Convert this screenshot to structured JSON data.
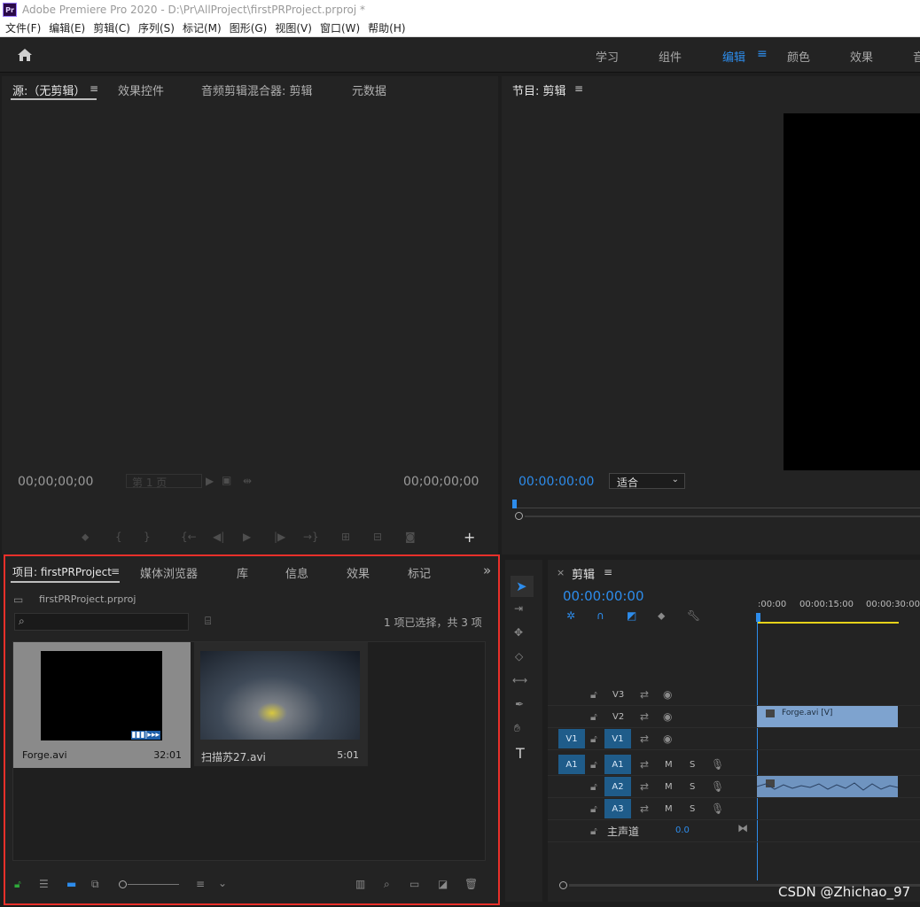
{
  "window": {
    "title": "Adobe Premiere Pro 2020 - D:\\Pr\\AllProject\\firstPRProject.prproj *",
    "logo": "Pr"
  },
  "menu": [
    "文件(F)",
    "编辑(E)",
    "剪辑(C)",
    "序列(S)",
    "标记(M)",
    "图形(G)",
    "视图(V)",
    "窗口(W)",
    "帮助(H)"
  ],
  "workspaces": {
    "items": [
      "学习",
      "组件",
      "编辑",
      "颜色",
      "效果",
      "音"
    ],
    "active": "编辑",
    "menu_icon": "≡"
  },
  "source": {
    "tabs": [
      "源:（无剪辑）",
      "效果控件",
      "音频剪辑混合器: 剪辑",
      "元数据"
    ],
    "menu_icon": "≡",
    "timecode_left": "00;00;00;00",
    "timecode_right": "00;00;00;00",
    "page": "第 1 页"
  },
  "program": {
    "title": "节目: 剪辑",
    "menu_icon": "≡",
    "timecode": "00:00:00:00",
    "fit": "适合"
  },
  "project": {
    "tabs": [
      "项目: firstPRProject",
      "媒体浏览器",
      "库",
      "信息",
      "效果",
      "标记"
    ],
    "menu_icon": "≡",
    "overflow_icon": "»",
    "file": "firstPRProject.prproj",
    "selection_status": "1 项已选择，共 3 项",
    "items": [
      {
        "name": "Forge.avi",
        "duration": "32:01",
        "selected": true
      },
      {
        "name": "扫描苏27.avi",
        "duration": "5:01",
        "selected": false
      }
    ]
  },
  "timeline": {
    "close": "×",
    "title": "剪辑",
    "menu_icon": "≡",
    "timecode": "00:00:00:00",
    "ruler": [
      ":00:00",
      "00:00:15:00",
      "00:00:30:00"
    ],
    "video_tracks": [
      {
        "name": "V3",
        "src": ""
      },
      {
        "name": "V2",
        "src": ""
      },
      {
        "name": "V1",
        "src": "V1"
      }
    ],
    "audio_tracks": [
      {
        "name": "A1",
        "src": "A1"
      },
      {
        "name": "A2",
        "src": ""
      },
      {
        "name": "A3",
        "src": ""
      }
    ],
    "mute": "M",
    "solo": "S",
    "master": {
      "label": "主声道",
      "value": "0.0"
    },
    "clip_v": "Forge.avi [V]"
  },
  "watermark": "CSDN @Zhichao_97",
  "colors": {
    "accent": "#2d8ceb",
    "highlight": "#e8302a",
    "clip_video": "#7ea3cf",
    "track_target": "#1f5c8a"
  }
}
